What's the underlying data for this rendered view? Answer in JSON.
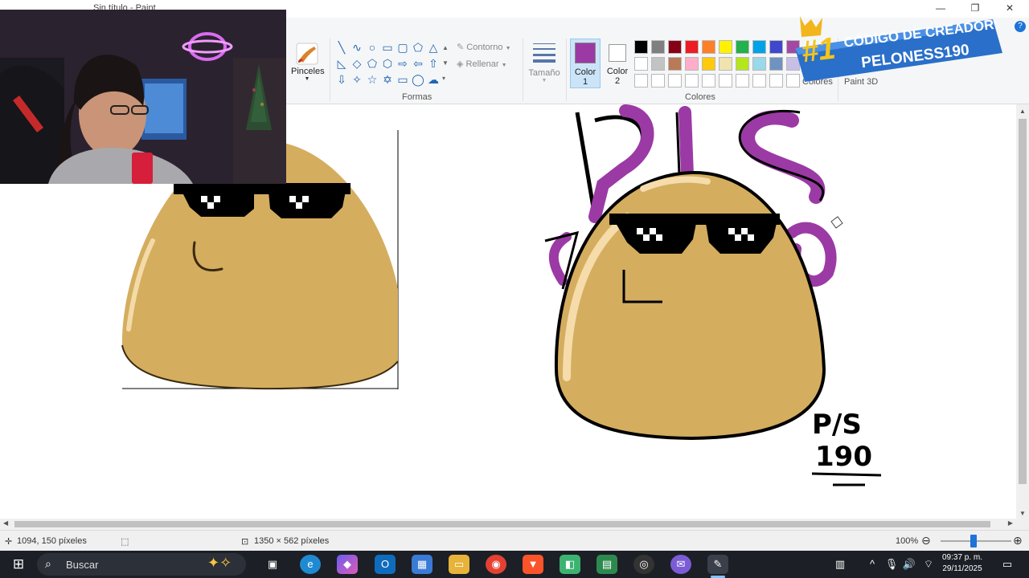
{
  "window": {
    "title": "Sin título - Paint",
    "min_icon": "minimize-icon",
    "restore_icon": "restore-icon",
    "close_icon": "close-icon"
  },
  "ribbon": {
    "brushes": {
      "label": "Pinceles"
    },
    "shapes": {
      "label": "Formas",
      "outline_label": "Contorno",
      "fill_label": "Rellenar"
    },
    "size": {
      "label": "Tamaño"
    },
    "color1": {
      "label": "Color",
      "num": "1",
      "value": "#9b3aa5"
    },
    "color2": {
      "label": "Color",
      "num": "2",
      "value": "#ffffff"
    },
    "colors": {
      "label": "Colores",
      "edit_label": "Colores"
    },
    "paint3d": {
      "label": "Paint 3D"
    },
    "palette_row1": [
      "#000000",
      "#7f7f7f",
      "#880015",
      "#ed1c24",
      "#ff7f27",
      "#fff200",
      "#22b14c",
      "#00a2e8",
      "#3f48cc",
      "#a349a4"
    ],
    "palette_row2": [
      "#ffffff",
      "#c3c3c3",
      "#b97a57",
      "#ffaec9",
      "#ffc90e",
      "#efe4b0",
      "#b5e61d",
      "#99d9ea",
      "#7092be",
      "#c8bfe7"
    ],
    "palette_row3": [
      "#ffffff",
      "#ffffff",
      "#ffffff",
      "#ffffff",
      "#ffffff",
      "#ffffff",
      "#ffffff",
      "#ffffff",
      "#ffffff",
      "#ffffff"
    ]
  },
  "banner": {
    "rank": "#1",
    "line1": "CÓDIGO DE CREADOR:",
    "line2": "PELONESS190"
  },
  "drawing": {
    "tag_line1": "P/S",
    "tag_line2": "190"
  },
  "status": {
    "cursor_pos": "1094, 150 píxeles",
    "image_size": "1350 × 562 píxeles",
    "zoom": "100%"
  },
  "taskbar": {
    "search_placeholder": "Buscar",
    "time": "09:37 p. m.",
    "date": "29/11/2025"
  }
}
